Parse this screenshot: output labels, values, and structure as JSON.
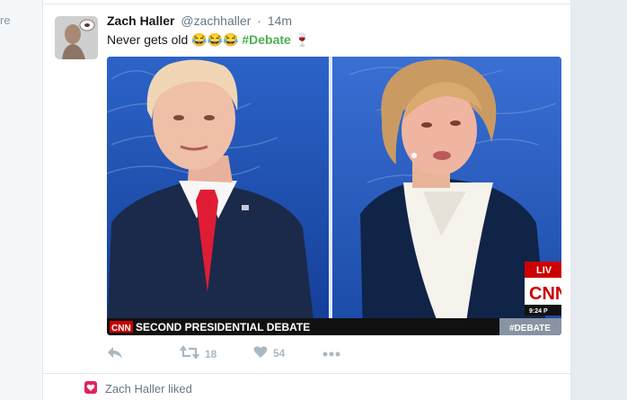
{
  "sidebar_fragment": "re",
  "tweet": {
    "fullname": "Zach Haller",
    "username": "@zachhaller",
    "separator": "·",
    "time": "14m",
    "text": "Never gets old",
    "emojis": "😂😂😂",
    "hashtag": "#Debate",
    "trailing_emoji": "🍷",
    "hashtag_color": "#4caf50",
    "media": {
      "network_logo": "CNN",
      "banner_title": "SECOND PRESIDENTIAL DEBATE",
      "corner_hashtag": "#DEBATE",
      "live_label": "LIV",
      "clock": "9:24 P"
    },
    "actions": {
      "reply_icon": "reply-icon",
      "retweet_count": "18",
      "like_count": "54",
      "more_icon": "more-icon"
    }
  },
  "activity": {
    "text": "Zach Haller liked",
    "icon": "heart-icon",
    "icon_color": "#e0245e"
  }
}
